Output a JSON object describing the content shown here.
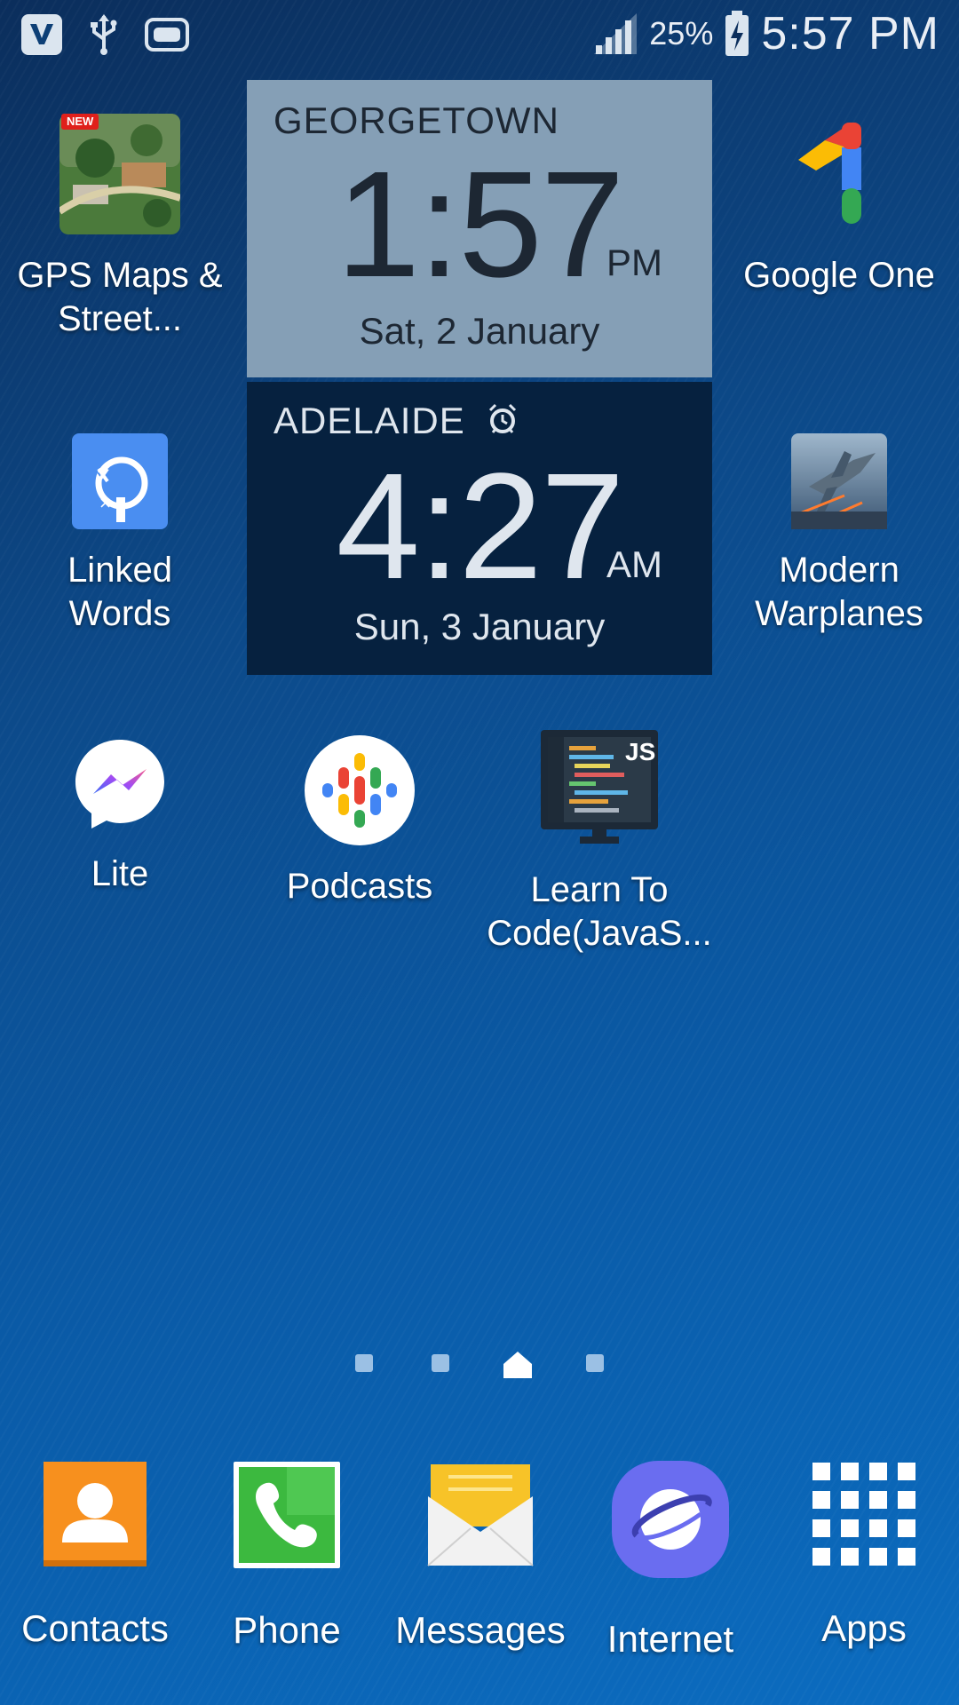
{
  "status_bar": {
    "notifications": [
      "v-app-icon",
      "usb-icon",
      "gamepad-icon"
    ],
    "signal": "signal-bars-icon",
    "battery_percent": "25%",
    "battery_icon": "battery-charging-icon",
    "time": "5:57 PM"
  },
  "apps": {
    "gps": {
      "label_line1": "GPS Maps &",
      "label_line2": "Street...",
      "badge": "NEW"
    },
    "google_one": {
      "label": "Google One"
    },
    "linked_words": {
      "label_line1": "Linked",
      "label_line2": "Words"
    },
    "modern_warplanes": {
      "label_line1": "Modern",
      "label_line2": "Warplanes"
    },
    "lite": {
      "label": "Lite"
    },
    "podcasts": {
      "label": "Podcasts"
    },
    "learn_code": {
      "label_line1": "Learn To",
      "label_line2": "Code(JavaS...",
      "badge": "JS"
    }
  },
  "clocks": [
    {
      "city": "GEORGETOWN",
      "time": "1:57",
      "ampm": "PM",
      "date": "Sat, 2 January"
    },
    {
      "city": "ADELAIDE",
      "time": "4:27",
      "ampm": "AM",
      "date": "Sun, 3 January",
      "icon": "alarm-icon"
    }
  ],
  "pager": {
    "pages": 4,
    "current_index": 2
  },
  "dock": [
    {
      "label": "Contacts",
      "icon": "contacts-icon"
    },
    {
      "label": "Phone",
      "icon": "phone-icon"
    },
    {
      "label": "Messages",
      "icon": "messages-icon"
    },
    {
      "label": "Internet",
      "icon": "internet-icon"
    },
    {
      "label": "Apps",
      "icon": "apps-grid-icon"
    }
  ],
  "colors": {
    "contacts": "#f7901e",
    "phone": "#3cb93f",
    "messages": "#f7c328",
    "internet": "#6a6df0",
    "clock_top": "#859fb6",
    "clock_bottom": "#06213f"
  }
}
